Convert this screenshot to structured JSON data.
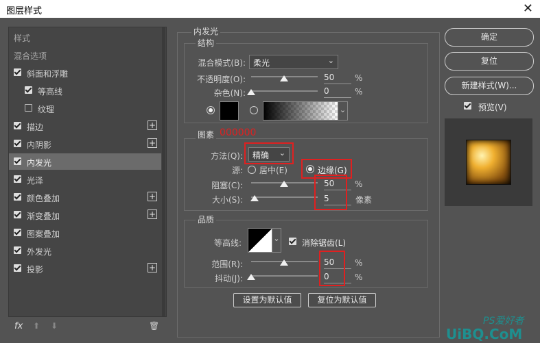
{
  "window": {
    "title": "图层样式",
    "close": "✕"
  },
  "left": {
    "items": [
      {
        "label": "样式",
        "checkbox": "none",
        "plus": false,
        "selected": false
      },
      {
        "label": "混合选项",
        "checkbox": "none",
        "plus": false,
        "selected": false
      },
      {
        "label": "斜面和浮雕",
        "checkbox": "on",
        "plus": false,
        "selected": false
      },
      {
        "label": "等高线",
        "checkbox": "on",
        "plus": false,
        "selected": false,
        "indent": true
      },
      {
        "label": "纹理",
        "checkbox": "off",
        "plus": false,
        "selected": false,
        "indent": true
      },
      {
        "label": "描边",
        "checkbox": "on",
        "plus": true,
        "selected": false
      },
      {
        "label": "内阴影",
        "checkbox": "on",
        "plus": true,
        "selected": false
      },
      {
        "label": "内发光",
        "checkbox": "on",
        "plus": false,
        "selected": true
      },
      {
        "label": "光泽",
        "checkbox": "on",
        "plus": false,
        "selected": false
      },
      {
        "label": "颜色叠加",
        "checkbox": "on",
        "plus": true,
        "selected": false
      },
      {
        "label": "渐变叠加",
        "checkbox": "on",
        "plus": true,
        "selected": false
      },
      {
        "label": "图案叠加",
        "checkbox": "on",
        "plus": false,
        "selected": false
      },
      {
        "label": "外发光",
        "checkbox": "on",
        "plus": false,
        "selected": false
      },
      {
        "label": "投影",
        "checkbox": "on",
        "plus": true,
        "selected": false
      }
    ],
    "plus_glyph": "+",
    "fx": "fx",
    "trash": "🗑"
  },
  "inner_glow": {
    "title": "内发光",
    "structure": {
      "title": "结构",
      "blend_mode_label": "混合模式(B):",
      "blend_mode_value": "柔光",
      "opacity_label": "不透明度(O):",
      "opacity_value": "50",
      "noise_label": "杂色(N):",
      "noise_value": "0",
      "percent": "%"
    },
    "elements": {
      "title": "图素",
      "color_code": "000000",
      "technique_label": "方法(Q):",
      "technique_value": "精确",
      "source_label": "源:",
      "source_center": "居中(E)",
      "source_edge": "边缘(G)",
      "choke_label": "阻塞(C):",
      "choke_value": "50",
      "size_label": "大小(S):",
      "size_value": "5",
      "size_unit": "像素",
      "percent": "%"
    },
    "quality": {
      "title": "品质",
      "contour_label": "等高线:",
      "antialias_label": "消除锯齿(L)",
      "range_label": "范围(R):",
      "range_value": "50",
      "jitter_label": "抖动(J):",
      "jitter_value": "0",
      "percent": "%"
    },
    "set_default": "设置为默认值",
    "reset_default": "复位为默认值"
  },
  "actions": {
    "ok": "确定",
    "reset": "复位",
    "new_style": "新建样式(W)...",
    "preview_label": "预览(V)"
  },
  "watermark": {
    "brand": "PS爱好者",
    "site": "UiBQ.CoM"
  },
  "colors": {
    "accent_red": "#e02020",
    "panel": "#454545",
    "bg": "#535353"
  }
}
